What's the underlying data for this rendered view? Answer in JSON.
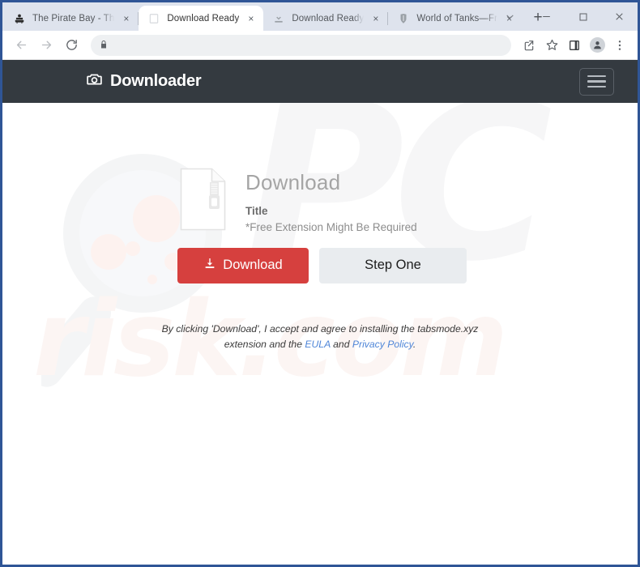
{
  "browser": {
    "tabs": [
      {
        "title": "The Pirate Bay - Th",
        "favicon": "pirate-bay-icon",
        "active": false,
        "close_label": "×"
      },
      {
        "title": "Download Ready",
        "favicon": "blank-page-icon",
        "active": true,
        "close_label": "×"
      },
      {
        "title": "Download Ready",
        "favicon": "download-icon",
        "active": false,
        "close_label": "×"
      },
      {
        "title": "World of Tanks—Fr",
        "favicon": "world-of-tanks-icon",
        "active": false,
        "close_label": "×"
      }
    ],
    "new_tab_label": "+",
    "window_controls": {
      "tab_search_label": "⌄",
      "minimize_label": "−",
      "maximize_label": "□",
      "close_label": "✕"
    },
    "toolbar": {
      "back_label": "←",
      "forward_label": "→",
      "reload_label": "↻",
      "address_value": "",
      "address_placeholder": "",
      "security_icon": "lock-icon",
      "share_icon": "share-icon",
      "bookmark_icon": "star-icon",
      "sidepanel_icon": "side-panel-icon",
      "profile_icon": "profile-avatar-icon",
      "menu_icon": "three-dot-menu-icon"
    }
  },
  "site": {
    "header": {
      "brand_name": "Downloader",
      "brand_icon": "camera-icon",
      "menu_button_icon": "hamburger-icon"
    },
    "card": {
      "file_icon": "zip-file-icon",
      "heading": "Download",
      "title": "Title",
      "note": "*Free Extension Might Be Required"
    },
    "buttons": {
      "download_label": "Download",
      "download_icon": "download-arrow-icon",
      "step_one_label": "Step One"
    },
    "legal": {
      "text_part1": "By clicking 'Download', I accept and agree to installing the tabsmode.xyz extension and the ",
      "eula_link": "EULA",
      "text_part2": " and ",
      "privacy_link": "Privacy Policy",
      "text_part3": "."
    },
    "watermark": {
      "brand_text": "PC",
      "domain_text": "risk.com",
      "logo_icon": "magnifying-glass-icon"
    },
    "colors": {
      "header_bg": "#343a40",
      "download_button": "#d6403e",
      "step_button": "#e9ecef",
      "link": "#4f86d8",
      "heading_text": "#a5a5a5"
    }
  }
}
